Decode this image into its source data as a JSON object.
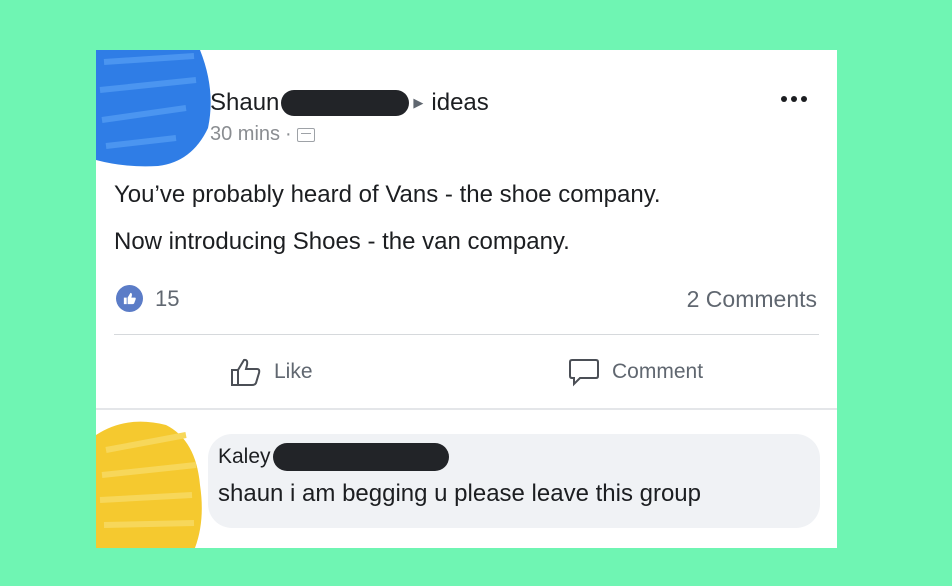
{
  "post": {
    "author_name": "Shaun",
    "group_name": "ideas",
    "timestamp": "30 mins",
    "separator": "·",
    "text_lines": [
      "You’ve probably heard of Vans - the shoe company.",
      "Now introducing Shoes - the van company."
    ],
    "like_count": "15",
    "comment_count": "2 Comments"
  },
  "actions": {
    "like_label": "Like",
    "comment_label": "Comment"
  },
  "comment": {
    "author_name": "Kaley",
    "text": "shaun i am begging u please leave this group"
  },
  "colors": {
    "background": "#6ff5b3",
    "like_badge": "#5b7cc7",
    "avatar_scribble_blue": "#2f7de6",
    "avatar_scribble_yellow": "#f5c92f"
  },
  "icons": {
    "privacy": "group-privacy-icon",
    "more": "more-options-icon",
    "reaction": "thumbs-up-icon",
    "like": "thumbs-up-outline-icon",
    "comment": "speech-bubble-icon"
  }
}
